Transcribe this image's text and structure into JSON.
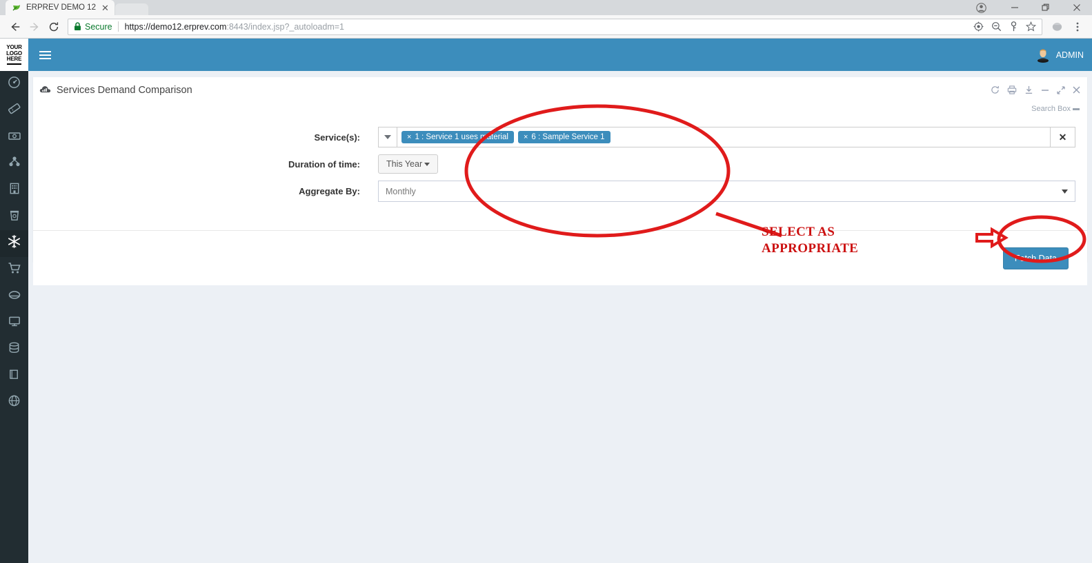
{
  "browser": {
    "tab": {
      "title": "ERPREV DEMO 12",
      "favicon_icon": "erprev-leaf-favicon",
      "close_icon": "tab-close-icon"
    },
    "window_controls": {
      "profile_icon": "profile-avatar-icon",
      "minimize_icon": "minimize-icon",
      "maximize_icon": "maximize-restore-icon",
      "close_icon": "window-close-icon"
    },
    "nav": {
      "back_icon": "back-arrow-icon",
      "forward_icon": "forward-arrow-icon",
      "reload_icon": "reload-icon"
    },
    "omnibox": {
      "lock_icon": "lock-icon",
      "security_label": "Secure",
      "url_scheme_host": "https://demo12.erprev.com",
      "url_rest": ":8443/index.jsp?_autoloadm=1",
      "url_full": "https://demo12.erprev.com:8443/index.jsp?_autoloadm=1",
      "icons": [
        "location-target-icon",
        "zoom-out-icon",
        "password-key-icon",
        "bookmark-star-icon"
      ]
    },
    "toolbar_right_icons": [
      "extension-globe-icon",
      "chrome-menu-icon"
    ]
  },
  "app": {
    "logo": {
      "line1": "YOUR",
      "line2": "LOGO",
      "line3": "HERE"
    },
    "navbar": {
      "menu_toggle_icon": "hamburger-menu-icon",
      "user_label": "ADMIN",
      "user_avatar_icon": "user-avatar-icon"
    },
    "sidebar": {
      "items": [
        {
          "name": "dashboard",
          "icon": "dashboard-gauge-icon",
          "active": false
        },
        {
          "name": "tickets",
          "icon": "tickets-icon",
          "active": false
        },
        {
          "name": "finance",
          "icon": "money-banknote-icon",
          "active": false
        },
        {
          "name": "organization",
          "icon": "sitemap-network-icon",
          "active": false
        },
        {
          "name": "facilities",
          "icon": "building-icon",
          "active": false
        },
        {
          "name": "waste",
          "icon": "trash-bin-icon",
          "active": false
        },
        {
          "name": "services",
          "icon": "snowflake-icon",
          "active": true
        },
        {
          "name": "purchasing",
          "icon": "shopping-cart-icon",
          "active": false
        },
        {
          "name": "inventory",
          "icon": "disc-stack-icon",
          "active": false
        },
        {
          "name": "monitoring",
          "icon": "monitor-screen-icon",
          "active": false
        },
        {
          "name": "database",
          "icon": "database-icon",
          "active": false
        },
        {
          "name": "library",
          "icon": "book-icon",
          "active": false
        },
        {
          "name": "web",
          "icon": "globe-icon",
          "active": false
        }
      ]
    }
  },
  "panel": {
    "title": "Services Demand Comparison",
    "title_icon": "bar-chart-cloud-icon",
    "tools": [
      {
        "name": "refresh",
        "icon": "refresh-icon"
      },
      {
        "name": "print",
        "icon": "printer-icon"
      },
      {
        "name": "download",
        "icon": "download-icon"
      },
      {
        "name": "collapse",
        "icon": "minus-icon"
      },
      {
        "name": "expand",
        "icon": "expand-arrows-icon"
      },
      {
        "name": "close",
        "icon": "close-x-icon"
      }
    ],
    "search_box_link": "Search Box",
    "search_box_icon": "search-box-toggle-icon"
  },
  "form": {
    "services": {
      "label": "Service(s):",
      "caret_icon": "dropdown-caret-icon",
      "clear_icon": "clear-x-icon",
      "tags": [
        {
          "remove_icon": "tag-remove-icon",
          "text": "1 : Service 1 uses material"
        },
        {
          "remove_icon": "tag-remove-icon",
          "text": "6 : Sample Service 1"
        }
      ]
    },
    "duration": {
      "label": "Duration of time:",
      "value": "This Year",
      "caret_icon": "caret-down-icon"
    },
    "aggregate": {
      "label": "Aggregate By:",
      "value": "Monthly",
      "caret_icon": "select-caret-icon"
    },
    "submit_label": "Fetch Data"
  },
  "annotations": {
    "callout_text_line1": "SELECT AS",
    "callout_text_line2": "APPROPRIATE",
    "color": "#cc1111",
    "ellipse_form": "red-ellipse-around-form-fields",
    "ellipse_button": "red-ellipse-around-fetch-data",
    "arrow_to_button": "red-arrow-pointing-at-fetch-data",
    "leader_line": "red-line-from-callout-to-ellipse"
  }
}
